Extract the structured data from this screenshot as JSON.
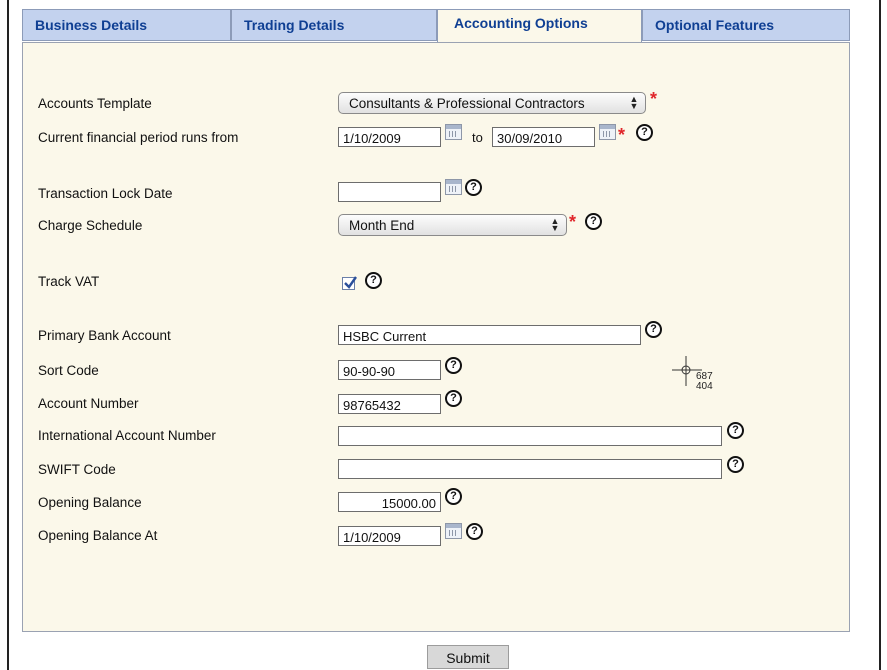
{
  "tabs": [
    {
      "label": "Business Details",
      "active": false
    },
    {
      "label": "Trading Details",
      "active": false
    },
    {
      "label": "Accounting Options",
      "active": true
    },
    {
      "label": "Optional Features",
      "active": false
    }
  ],
  "form": {
    "accounts_template": {
      "label": "Accounts Template",
      "value": "Consultants & Professional Contractors"
    },
    "financial_period": {
      "label": "Current financial period runs from",
      "from": "1/10/2009",
      "to_text": "to",
      "to": "30/09/2010"
    },
    "transaction_lock_date": {
      "label": "Transaction Lock Date",
      "value": ""
    },
    "charge_schedule": {
      "label": "Charge Schedule",
      "value": "Month End"
    },
    "track_vat": {
      "label": "Track VAT",
      "checked": true
    },
    "primary_bank_account": {
      "label": "Primary Bank Account",
      "value": "HSBC Current"
    },
    "sort_code": {
      "label": "Sort Code",
      "value": "90-90-90"
    },
    "account_number": {
      "label": "Account Number",
      "value": "98765432"
    },
    "international_account_number": {
      "label": "International Account Number",
      "value": ""
    },
    "swift_code": {
      "label": "SWIFT Code",
      "value": ""
    },
    "opening_balance": {
      "label": "Opening Balance",
      "value": "15000.00"
    },
    "opening_balance_at": {
      "label": "Opening Balance At",
      "value": "1/10/2009"
    }
  },
  "required_marker": "*",
  "help_glyph": "?",
  "cursor_readout": {
    "x": "687",
    "y": "404"
  },
  "submit_label": "Submit",
  "colors": {
    "tab_bg": "#c3d2ee",
    "tab_text": "#0f3f93",
    "panel_bg": "#fbf8ea",
    "required": "#e0262b"
  }
}
